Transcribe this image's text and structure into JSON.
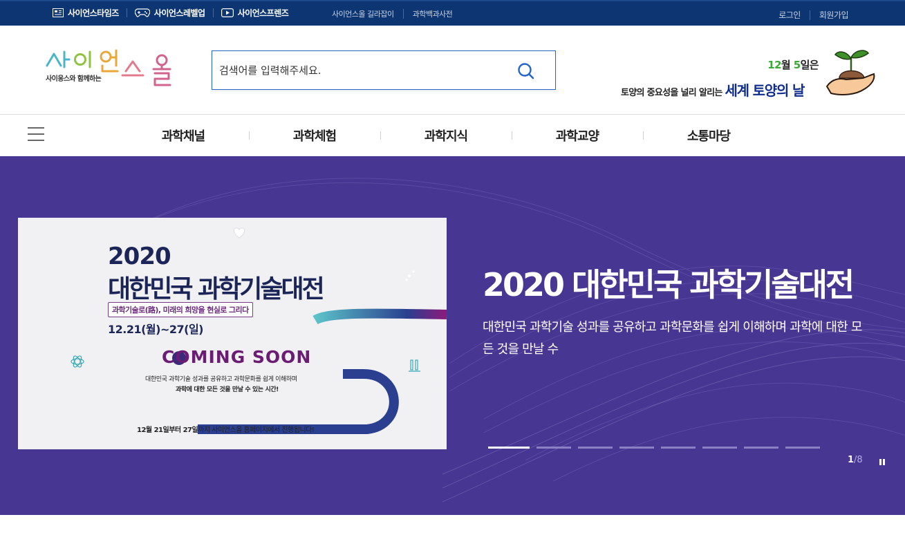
{
  "topbar": {
    "family": [
      {
        "label": "사이언스타임즈",
        "icon": "newspaper-icon"
      },
      {
        "label": "사이언스레벨업",
        "icon": "gamepad-icon"
      },
      {
        "label": "사이언스프렌즈",
        "icon": "play-icon"
      }
    ],
    "links": [
      "사이언스올 길라잡이",
      "과학백과사전"
    ],
    "login": "로그인",
    "signup": "회원가입"
  },
  "header": {
    "logo_text": "사이언스올",
    "logo_sub": "사이웅스와 함께하는",
    "search_placeholder": "검색어를 입력해주세요.",
    "promo": {
      "month": "12",
      "month_unit": "월 ",
      "day": "5",
      "day_unit": "일은",
      "line2": "토양의 중요성을 널리 알리는 ",
      "line2_big": "세계 토양의 날"
    }
  },
  "gnb": [
    "과학채널",
    "과학체험",
    "과학지식",
    "과학교양",
    "소통마당"
  ],
  "banner": {
    "year": "2020",
    "title": "대한민국 과학기술대전",
    "tag": "과학기술로(路), 미래의 희망을 현실로 그리다",
    "date": "12.21(월)~27(일)",
    "coming": "COMING SOON",
    "desc1": "대한민국 과학기술 성과를 공유하고 과학문화를 쉽게 이해하며",
    "desc2": "과학에 대한 모든 것을 만날 수 있는 시간!",
    "foot_bold": "12월 21일부터 27일",
    "foot": "까지 사이언스올 홈페이지에서 진행됩니다!"
  },
  "hero": {
    "title": "2020 대한민국 과학기술대전",
    "desc": "대한민국 과학기술 성과를 공유하고 과학문화를 쉽게 이해하며 과학에 대한 모든 것을 만날 수",
    "current": "1",
    "total": "/8"
  },
  "colors": {
    "topbar": "#0d3572",
    "hero_bg": "#473692",
    "search_border": "#2366c6",
    "banner_navy": "#1b2557",
    "banner_purple": "#6b1d74"
  }
}
